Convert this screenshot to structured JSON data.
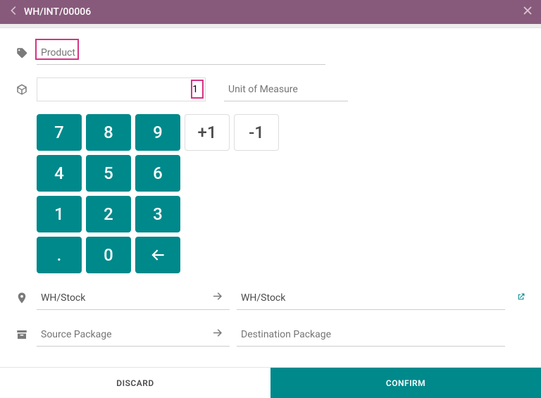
{
  "header": {
    "title": "WH/INT/00006"
  },
  "product": {
    "placeholder": "Product",
    "value": ""
  },
  "quantity": {
    "value": "1"
  },
  "uom": {
    "placeholder": "Unit of Measure",
    "value": ""
  },
  "keypad": {
    "k7": "7",
    "k8": "8",
    "k9": "9",
    "plus1": "+1",
    "minus1": "-1",
    "k4": "4",
    "k5": "5",
    "k6": "6",
    "k1": "1",
    "k2": "2",
    "k3": "3",
    "dot": ".",
    "k0": "0"
  },
  "location": {
    "source": "WH/Stock",
    "destination": "WH/Stock"
  },
  "package": {
    "source_placeholder": "Source Package",
    "destination_placeholder": "Destination Package"
  },
  "footer": {
    "discard": "DISCARD",
    "confirm": "CONFIRM"
  }
}
